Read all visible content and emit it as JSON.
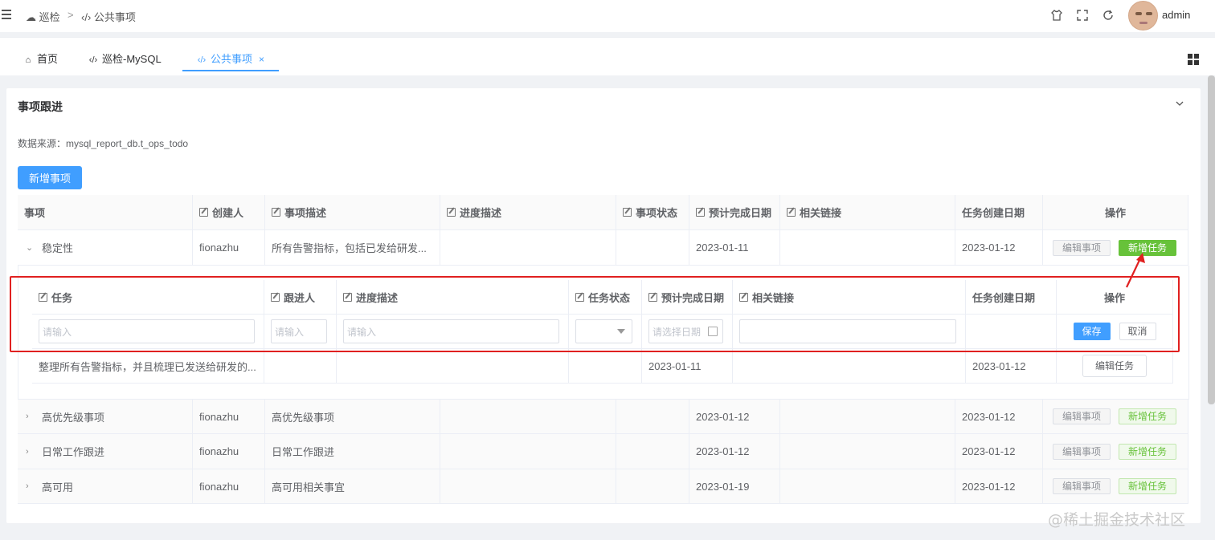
{
  "header": {
    "breadcrumb": [
      {
        "label": "巡检",
        "icon": "cloud-icon"
      },
      {
        "label": "公共事项",
        "icon": "code-icon"
      }
    ],
    "breadcrumb_separator": ">",
    "username": "admin"
  },
  "tabs": [
    {
      "label": "首页",
      "icon": "home-icon",
      "active": false
    },
    {
      "label": "巡检-MySQL",
      "icon": "code-icon",
      "active": false
    },
    {
      "label": "公共事项",
      "icon": "code-icon",
      "active": true,
      "closable": true,
      "close_glyph": "×"
    }
  ],
  "card": {
    "title": "事项跟进",
    "source_note": "数据来源：mysql_report_db.t_ops_todo",
    "add_item_button": "新增事项"
  },
  "main_table": {
    "headers": [
      "事项",
      "创建人",
      "事项描述",
      "进度描述",
      "事项状态",
      "预计完成日期",
      "相关链接",
      "任务创建日期",
      "操作"
    ],
    "rows": [
      {
        "item": "稳定性",
        "creator": "fionazhu",
        "description": "所有告警指标，包括已发给研发...",
        "progress": "",
        "status": "",
        "due_date": "2023-01-11",
        "link": "",
        "created": "2023-01-12",
        "expanded": true
      },
      {
        "item": "高优先级事项",
        "creator": "fionazhu",
        "description": "高优先级事项",
        "progress": "",
        "status": "",
        "due_date": "2023-01-12",
        "link": "",
        "created": "2023-01-12",
        "expanded": false
      },
      {
        "item": "日常工作跟进",
        "creator": "fionazhu",
        "description": "日常工作跟进",
        "progress": "",
        "status": "",
        "due_date": "2023-01-12",
        "link": "",
        "created": "2023-01-12",
        "expanded": false
      },
      {
        "item": "高可用",
        "creator": "fionazhu",
        "description": "高可用相关事宜",
        "progress": "",
        "status": "",
        "due_date": "2023-01-19",
        "link": "",
        "created": "2023-01-12",
        "expanded": false
      }
    ],
    "edit_item_button": "编辑事项",
    "add_task_button": "新增任务"
  },
  "sub_table": {
    "headers": [
      "任务",
      "跟进人",
      "进度描述",
      "任务状态",
      "预计完成日期",
      "相关链接",
      "任务创建日期",
      "操作"
    ],
    "new_row": {
      "task_placeholder": "请输入",
      "owner_placeholder": "请输入",
      "progress_placeholder": "请输入",
      "date_placeholder": "请选择日期",
      "save_button": "保存",
      "cancel_button": "取消"
    },
    "rows": [
      {
        "task": "整理所有告警指标，并且梳理已发送给研发的...",
        "owner": "",
        "progress": "",
        "status": "",
        "due_date": "2023-01-11",
        "link": "",
        "created": "2023-01-12"
      }
    ],
    "edit_task_button": "编辑任务"
  },
  "annotation_color": "#e02020",
  "accent_color": "#409eff",
  "success_color": "#67c23a",
  "watermark": "@稀土掘金技术社区"
}
